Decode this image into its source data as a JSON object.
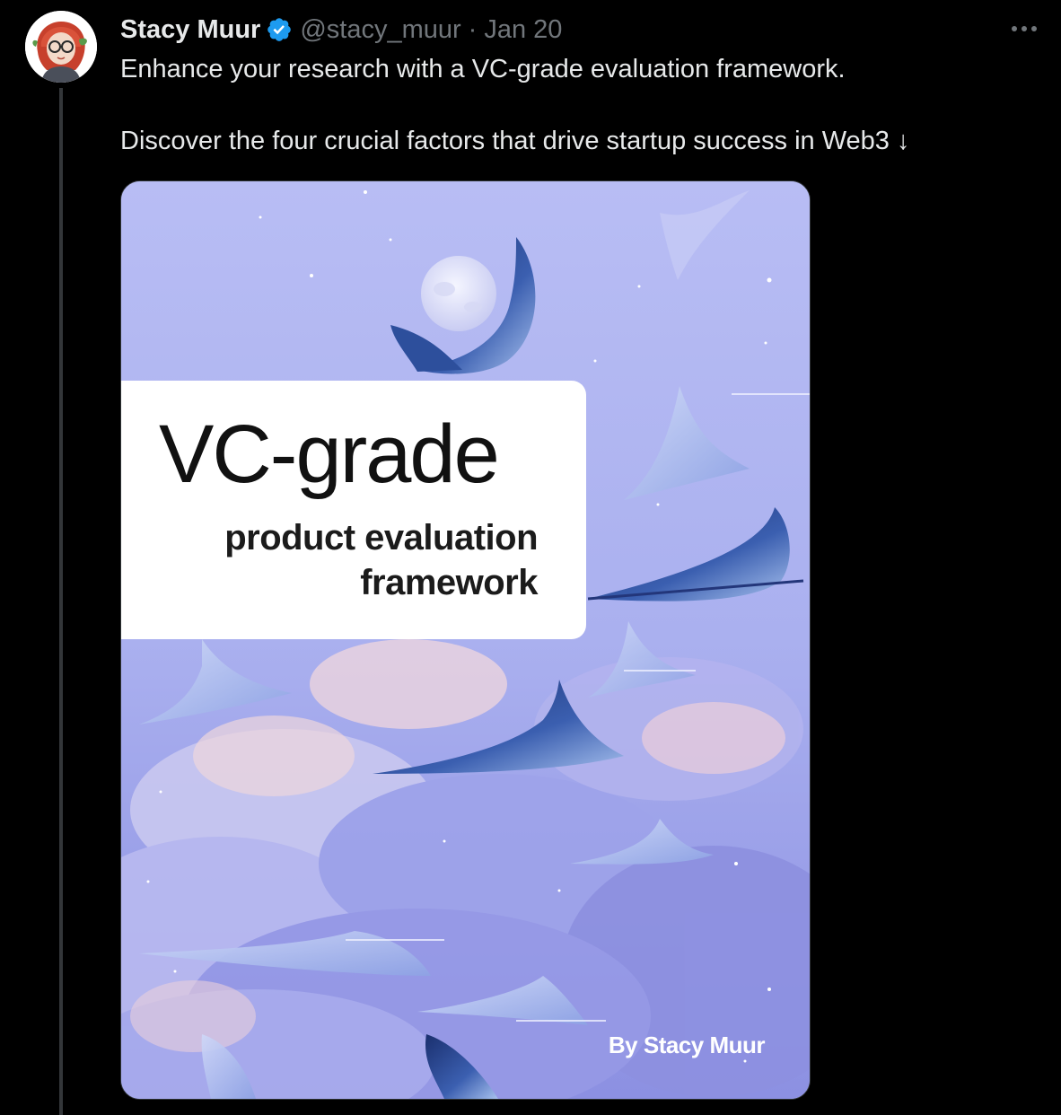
{
  "tweet": {
    "author": {
      "display_name": "Stacy Muur",
      "handle": "@stacy_muur",
      "separator": "·",
      "date": "Jan 20",
      "verified": true,
      "avatar_icon": "avatar-illustration-icon"
    },
    "text_line_1": "Enhance your research with a VC-grade evaluation framework.",
    "text_line_2": "Discover the four crucial factors that drive startup success in Web3 ↓",
    "more_icon": "more-options-icon"
  },
  "media": {
    "title": "VC-grade",
    "subtitle_line_1": "product evaluation",
    "subtitle_line_2": "framework",
    "byline": "By Stacy Muur"
  },
  "colors": {
    "background": "#000000",
    "text_primary": "#e7e9ea",
    "text_secondary": "#71767b",
    "verified_blue": "#1d9bf0",
    "thread_line": "#333639",
    "art_sky": "#aab0ee"
  }
}
